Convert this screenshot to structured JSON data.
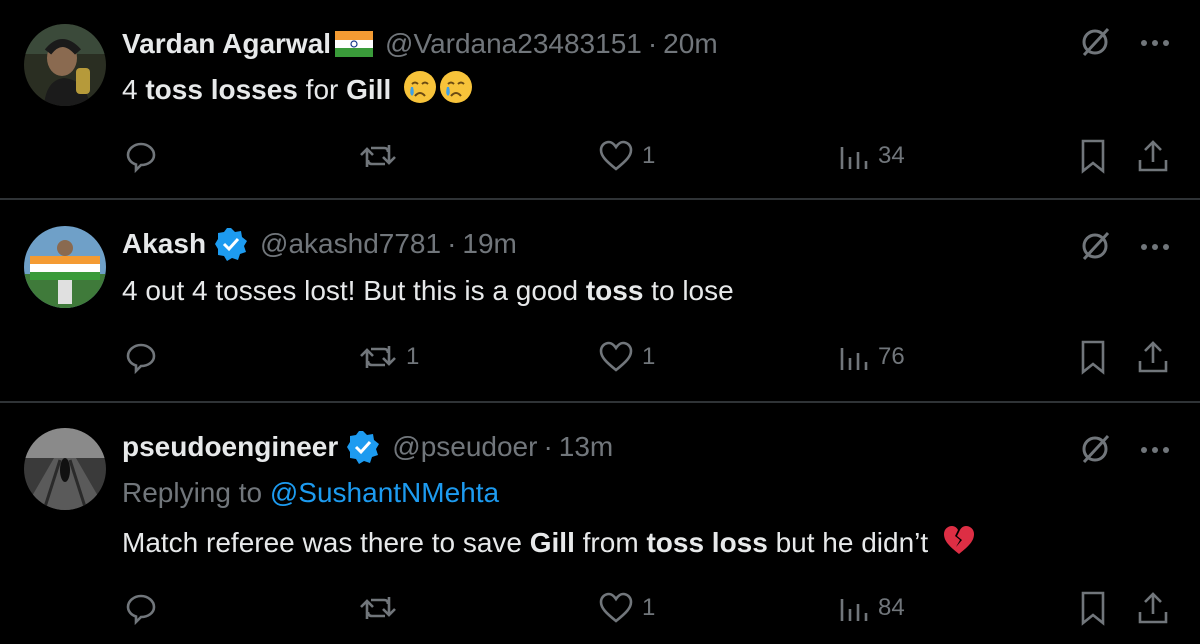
{
  "tweets": [
    {
      "name": "Vardan Agarwal",
      "handle": "@Vardana23483151",
      "time": "20m",
      "has_flag": true,
      "verified": false,
      "text_parts": [
        {
          "t": "4 ",
          "b": false
        },
        {
          "t": "toss losses",
          "b": true
        },
        {
          "t": " for ",
          "b": false
        },
        {
          "t": "Gill",
          "b": true
        }
      ],
      "emoji": [
        "crying-face",
        "crying-face"
      ],
      "stats": {
        "replies": "",
        "retweets": "",
        "likes": "1",
        "views": "34"
      }
    },
    {
      "name": "Akash",
      "handle": "@akashd7781",
      "time": "19m",
      "has_flag": false,
      "verified": true,
      "text_parts": [
        {
          "t": "4 out 4 tosses lost! But this is a good ",
          "b": false
        },
        {
          "t": "toss",
          "b": true
        },
        {
          "t": " to lose",
          "b": false
        }
      ],
      "emoji": [],
      "stats": {
        "replies": "",
        "retweets": "1",
        "likes": "1",
        "views": "76"
      }
    },
    {
      "name": "pseudoengineer",
      "handle": "@pseudoer",
      "time": "13m",
      "has_flag": false,
      "verified": true,
      "replying_to": {
        "prefix": "Replying to ",
        "mention": "@SushantNMehta"
      },
      "text_parts": [
        {
          "t": "Match referee was there to save ",
          "b": false
        },
        {
          "t": "Gill",
          "b": true
        },
        {
          "t": " from ",
          "b": false
        },
        {
          "t": "toss loss",
          "b": true
        },
        {
          "t": " but he didn’t",
          "b": false
        }
      ],
      "emoji": [
        "broken-heart"
      ],
      "stats": {
        "replies": "",
        "retweets": "",
        "likes": "1",
        "views": "84"
      }
    }
  ],
  "colors": {
    "background": "#000000",
    "text": "#e7e9ea",
    "muted": "#71767b",
    "accent": "#1d9bf0",
    "divider": "#2f3336"
  },
  "separator": "·"
}
